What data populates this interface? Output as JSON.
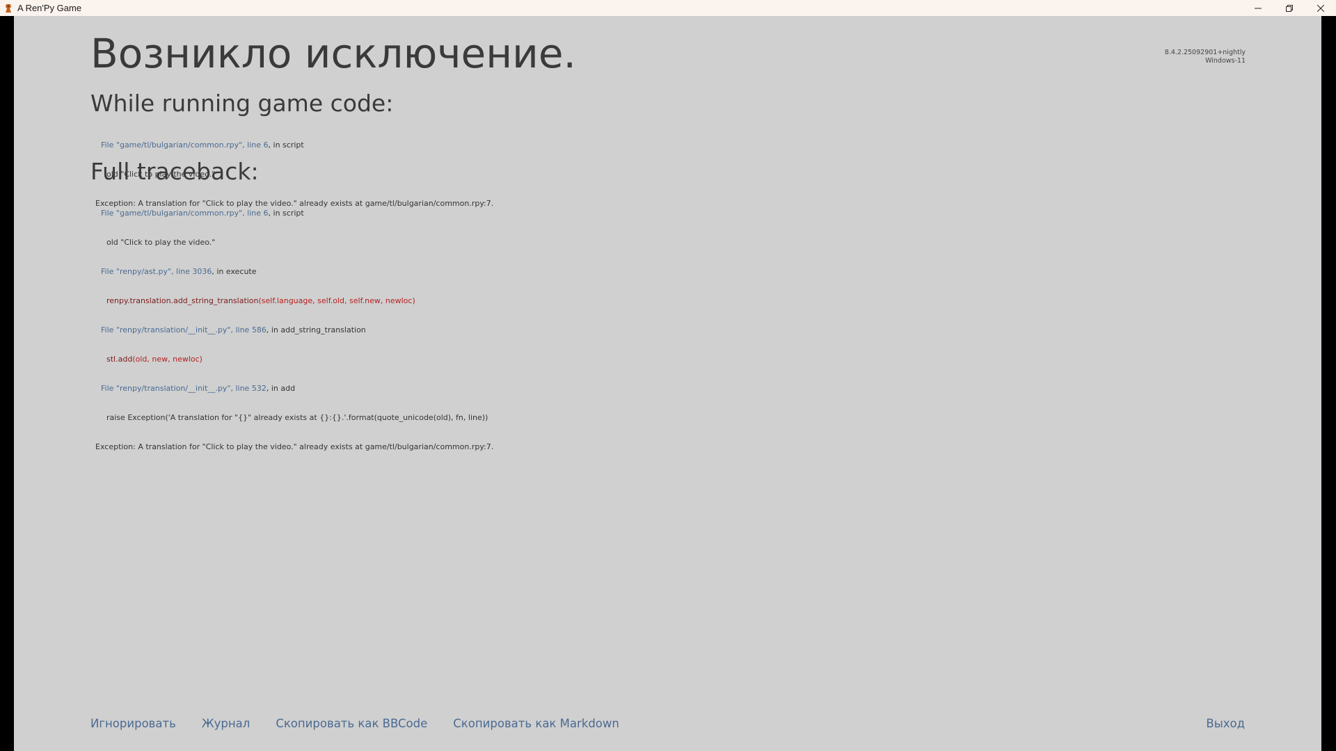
{
  "window": {
    "title": "A Ren'Py Game",
    "controls": [
      "minimize-icon",
      "restore-icon",
      "close-icon"
    ]
  },
  "version": {
    "line1": "8.4.2.25092901+nightly",
    "line2": "Windows-11"
  },
  "heading": "Возникло исключение.",
  "game_code": {
    "title": "While running game code:",
    "file1": "File \"game/tl/bulgarian/common.rpy\", line 6",
    "file1_in": ", in script",
    "code1": "old \"Click to play the video.\"",
    "exception": "Exception: A translation for \"Click to play the video.\" already exists at game/tl/bulgarian/common.rpy:7."
  },
  "full_traceback": {
    "title": "Full traceback:",
    "f1": "File \"game/tl/bulgarian/common.rpy\", line 6",
    "f1_in": ", in script",
    "c1": "old \"Click to play the video.\"",
    "f2": "File \"renpy/ast.py\", line 3036",
    "f2_in": ", in execute",
    "c2_fn": "renpy.translation.add_string_translation",
    "c2_args": "(self.language, self.old, self.new, newloc)",
    "f3": "File \"renpy/translation/__init__.py\", line 586",
    "f3_in": ", in add_string_translation",
    "c3_fn": "stl.add",
    "c3_args": "(old, new, newloc)",
    "f4": "File \"renpy/translation/__init__.py\", line 532",
    "f4_in": ", in add",
    "c4": "raise Exception('A translation for \"{}\" already exists at {}:{}.'.format(quote_unicode(old), fn, line))",
    "exception": "Exception: A translation for \"Click to play the video.\" already exists at game/tl/bulgarian/common.rpy:7."
  },
  "buttons": {
    "ignore": "Игнорировать",
    "log": "Журнал",
    "copy_bbcode": "Скопировать как BBCode",
    "copy_markdown": "Скопировать как Markdown",
    "exit": "Выход"
  },
  "colors": {
    "background": "#d0d0d0",
    "link": "#4a6a92",
    "code_error": "#b51f1f"
  }
}
